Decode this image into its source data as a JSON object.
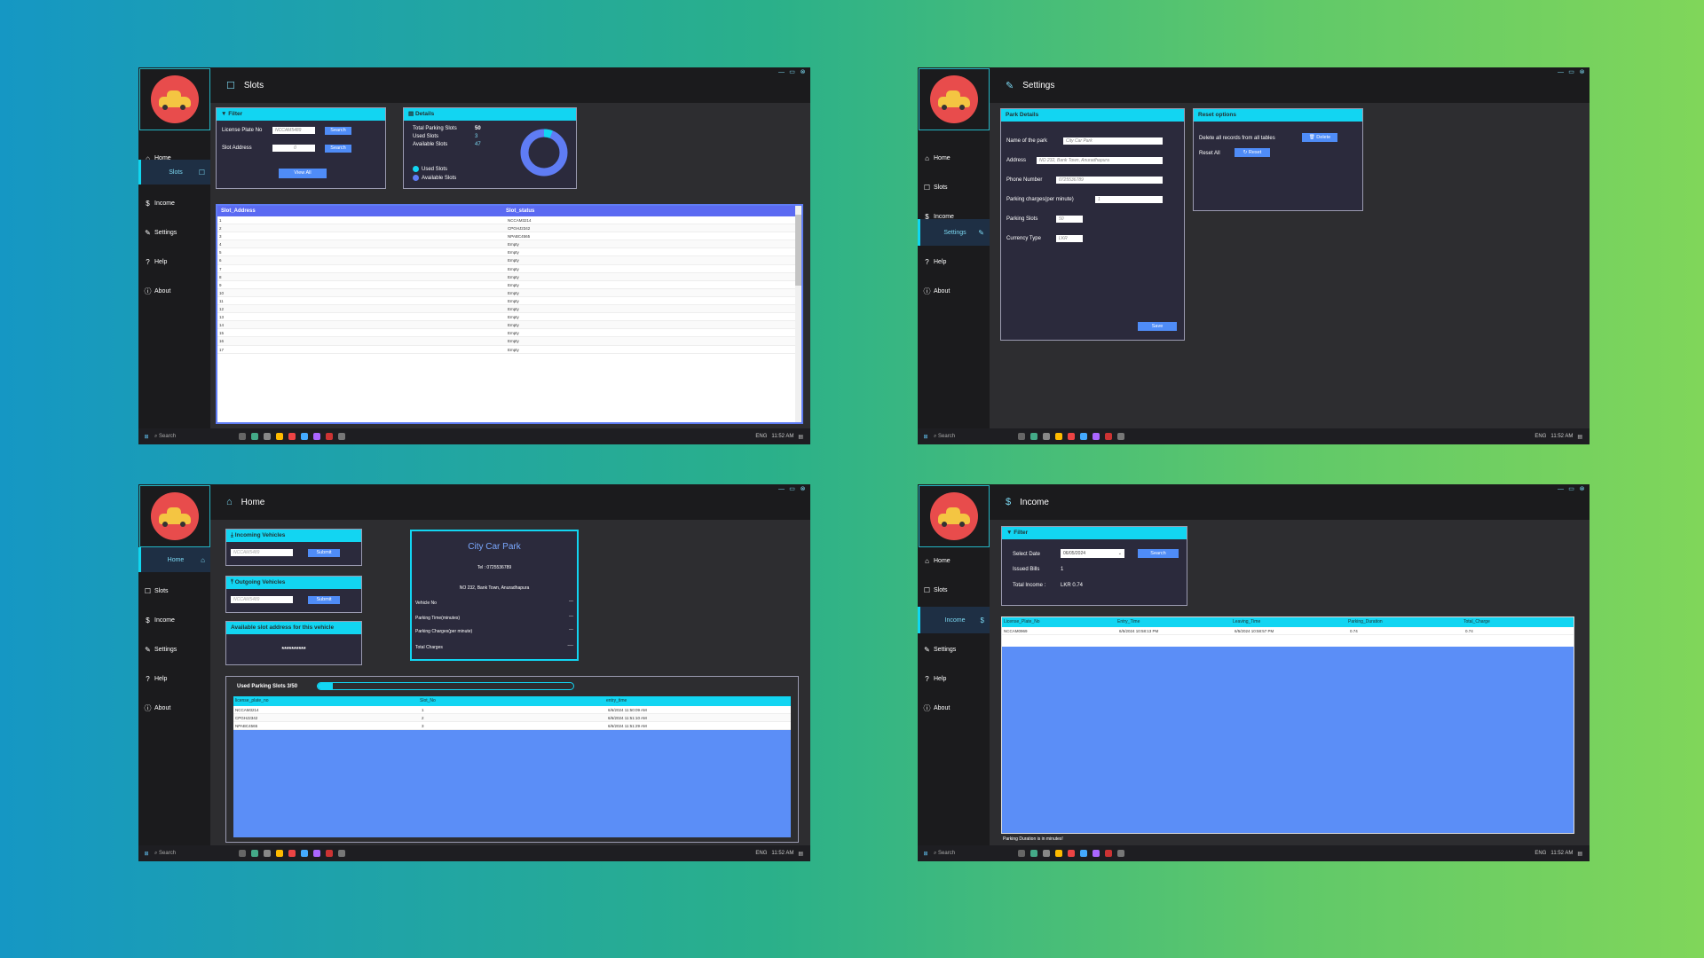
{
  "nav": {
    "home": "Home",
    "slots": "Slots",
    "income": "Income",
    "settings": "Settings",
    "help": "Help",
    "about": "About"
  },
  "taskbar": {
    "search": "Search",
    "lang": "ENG",
    "time": "11:52 AM"
  },
  "slots": {
    "title": "Slots",
    "filter": {
      "header": "Filter",
      "plate_label": "License Plate No",
      "plate_value": "NCCAM5489",
      "slot_label": "Slot Address",
      "slot_value": "0",
      "search": "Search",
      "view_all": "View All"
    },
    "details": {
      "header": "Details",
      "total_label": "Total Parking Slots",
      "total_value": "50",
      "used_label": "Used Slots",
      "used_value": "3",
      "available_label": "Available Slots",
      "available_value": "47",
      "legend_used": "Used Slots",
      "legend_available": "Available Slots",
      "used_color": "#12d5f2",
      "available_color": "#5f7cf4"
    },
    "table": {
      "col1": "Slot_Address",
      "col2": "Slot_status",
      "rows": [
        [
          "1",
          "NCCAM3214"
        ],
        [
          "2",
          "CPGHJ2342"
        ],
        [
          "3",
          "NPABC4565"
        ],
        [
          "4",
          "Empty"
        ],
        [
          "5",
          "Empty"
        ],
        [
          "6",
          "Empty"
        ],
        [
          "7",
          "Empty"
        ],
        [
          "8",
          "Empty"
        ],
        [
          "9",
          "Empty"
        ],
        [
          "10",
          "Empty"
        ],
        [
          "11",
          "Empty"
        ],
        [
          "12",
          "Empty"
        ],
        [
          "13",
          "Empty"
        ],
        [
          "14",
          "Empty"
        ],
        [
          "15",
          "Empty"
        ],
        [
          "16",
          "Empty"
        ],
        [
          "17",
          "Empty"
        ]
      ]
    }
  },
  "settings": {
    "title": "Settings",
    "park": {
      "header": "Park Details",
      "name_label": "Name of the park",
      "name_value": "City Car Park",
      "address_label": "Address",
      "address_value": "NO 232, Bank Town, Anuradhapura",
      "phone_label": "Phone Number",
      "phone_value": "0725536789",
      "charge_label": "Parking charges(per minute)",
      "charge_value": "1",
      "slots_label": "Parking Slots",
      "slots_value": "50",
      "currency_label": "Currency Type",
      "currency_value": "LKR",
      "save": "Save"
    },
    "reset": {
      "header": "Reset options",
      "delete_label": "Delete all records from all tables",
      "delete_btn": "Delete",
      "reset_label": "Reset All",
      "reset_btn": "Reset"
    }
  },
  "home": {
    "title": "Home",
    "incoming": {
      "header": "Incoming Vehicles",
      "placeholder": "NCCAM5489",
      "submit": "Submit"
    },
    "outgoing": {
      "header": "Outgoing Vehicles",
      "placeholder": "NCCAM5489",
      "submit": "Submit"
    },
    "available": {
      "header": "Available slot address for this vehicle",
      "value": "**********"
    },
    "receipt": {
      "name": "City Car Park",
      "tel": "Tel : 0725536789",
      "address": "NO 232, Bank Town, Anuradhapura",
      "vehicle_label": "Vehicle No",
      "vehicle_value": "---",
      "time_label": "Parking Time(minutes)",
      "time_value": "---",
      "charge_label": "Parking Charges(per minute)",
      "charge_value": "---",
      "total_label": "Total Charges",
      "total_value": "----"
    },
    "used": {
      "label": "Used Parking Slots 3/50",
      "fraction": 0.06
    },
    "table": {
      "cols": [
        "license_plate_no",
        "Slot_No",
        "entry_time"
      ],
      "rows": [
        [
          "NCCAM3214",
          "1",
          "6/6/2024 11:50:09 AM"
        ],
        [
          "CPGHJ2342",
          "2",
          "6/6/2024 11:51:10 AM"
        ],
        [
          "NPABC4565",
          "3",
          "6/6/2024 11:51:29 AM"
        ]
      ]
    }
  },
  "income": {
    "title": "Income",
    "filter": {
      "header": "Filter",
      "date_label": "Select Date",
      "date_value": "06/05/2024",
      "search": "Search",
      "bills_label": "Issued Bills",
      "bills_value": "1",
      "total_label": "Total Income :",
      "total_value": "LKR 0.74"
    },
    "table": {
      "cols": [
        "License_Plate_No",
        "Entry_Time",
        "Leaving_Time",
        "Parking_Duration",
        "Total_Charge"
      ],
      "rows": [
        [
          "NCCAM0969",
          "6/5/2024 10:58:13 PM",
          "6/5/2024 10:58:57 PM",
          "0.74",
          "0.74"
        ]
      ]
    },
    "note": "Parking Duration is in minutes!"
  }
}
